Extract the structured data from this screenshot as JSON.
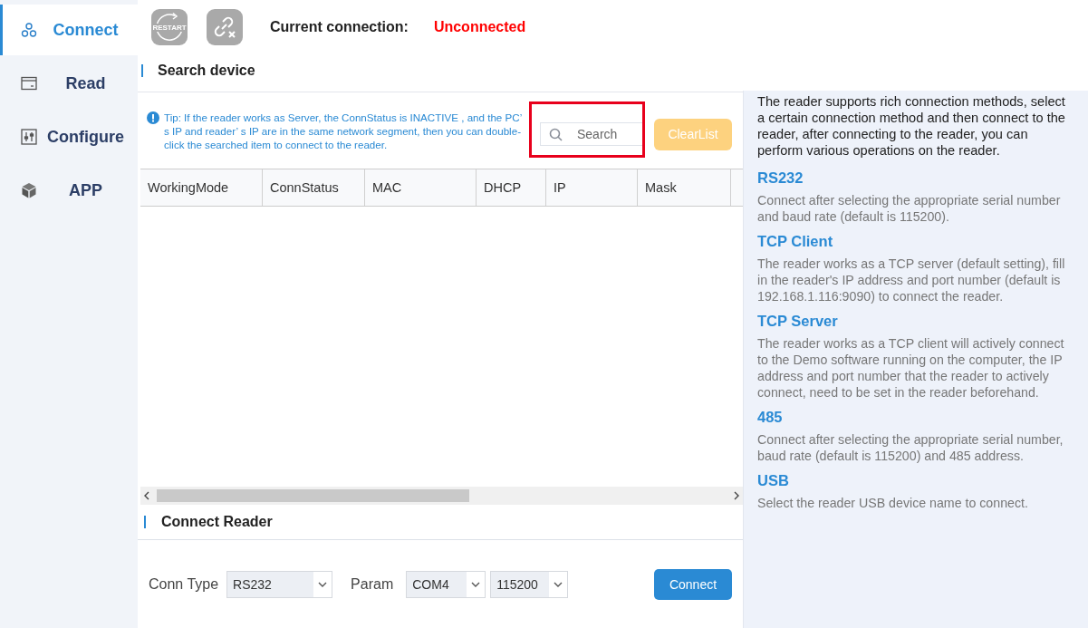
{
  "sidebar": {
    "items": [
      {
        "label": "Connect",
        "kind": "nodes",
        "selected": true
      },
      {
        "label": "Read",
        "kind": "card",
        "selected": false
      },
      {
        "label": "Configure",
        "kind": "sliders",
        "selected": false
      },
      {
        "label": "APP",
        "kind": "cube",
        "selected": false
      }
    ]
  },
  "toolbar": {
    "restart_label": "RESTART",
    "connection_label": "Current connection:",
    "connection_status": "Unconnected",
    "connected": false
  },
  "search_section": {
    "title": "Search device",
    "tip": "Tip: If the reader works as Server, the ConnStatus is INACTIVE , and the PC’ s IP and reader’ s IP are in the same network segment, then you can double-click the searched item to connect to the reader.",
    "search": {
      "placeholder": "Search",
      "highlighted": true
    },
    "clear_button": {
      "label": "ClearList",
      "disabled": true
    },
    "table": {
      "columns": [
        "WorkingMode",
        "ConnStatus",
        "MAC",
        "DHCP",
        "IP",
        "Mask"
      ]
    }
  },
  "connect_section": {
    "title": "Connect Reader",
    "conn_type_label": "Conn Type",
    "conn_type": "RS232",
    "param_label": "Param",
    "port": "COM4",
    "baud": "115200",
    "connect_button": "Connect"
  },
  "help": {
    "intro": "The reader supports rich connection methods, select a certain connection method and then connect to the reader, after connecting to the reader, you can perform various operations on the reader.",
    "methods": [
      {
        "title": "RS232",
        "text": "Connect after selecting the appropriate serial number and baud rate (default is 115200)."
      },
      {
        "title": "TCP Client",
        "text": "The reader works as a TCP server (default setting), fill in the reader's IP address and port number (default is 192.168.1.116:9090) to connect the reader."
      },
      {
        "title": "TCP Server",
        "text": "The reader works as a TCP client will actively connect to the Demo software running on the computer, the IP address and port number that the reader to actively connect, need  to be set in the reader beforehand."
      },
      {
        "title": "485",
        "text": "Connect after selecting the appropriate serial number, baud rate (default is 115200) and 485 address."
      },
      {
        "title": "USB",
        "text": "Select the reader USB device name to connect."
      }
    ]
  }
}
